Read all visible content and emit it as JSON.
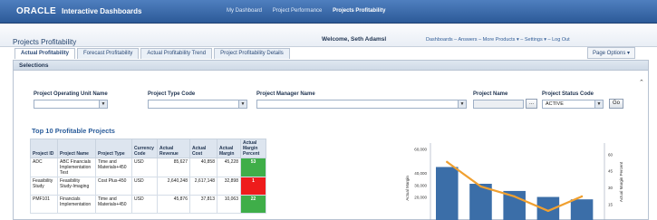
{
  "brand": {
    "logo": "ORACLE",
    "product": "Interactive Dashboards"
  },
  "top_nav": [
    "My Dashboard",
    "Project Performance",
    "Projects Profitability"
  ],
  "top_nav_active": 2,
  "page_title": "Projects Profitability",
  "welcome": "Welcome, Seth Adamsl",
  "right_links": "Dashboards – Answers – More Products ▾ – Settings ▾ – Log Out",
  "tabs": [
    "Actual Profitability",
    "Forecast Profitability",
    "Actual Profitability Trend",
    "Project Profitability Details"
  ],
  "active_tab": 0,
  "page_options": "Page Options ▾",
  "selections": {
    "title": "Selections",
    "prompts": {
      "operating_unit": "Project Operating Unit Name",
      "type_code": "Project Type Code",
      "manager": "Project Manager Name",
      "project_name": "Project Name",
      "status": "Project Status Code"
    },
    "status_value": "ACTIVE",
    "browse_label": "...",
    "go_label": "Go"
  },
  "section_title": "Top 10 Profitable Projects",
  "table": {
    "headers": [
      "Project ID",
      "Project Name",
      "Project Type",
      "Currency Code",
      "Actual Revenue",
      "Actual Cost",
      "Actual Margin",
      "Actual Margin Percent"
    ],
    "rows": [
      [
        "ADC",
        "ABC Financials Implementation Test",
        "Time and Materials+450",
        "USD",
        "85,627",
        "40,858",
        "45,228",
        "53"
      ],
      [
        "Feasibility Study",
        "Feasibility Study-Imaging",
        "Cost Plus-450",
        "USD",
        "2,640,248",
        "2,617,148",
        "32,898",
        "1"
      ],
      [
        "PMF101",
        "Financials Implementation",
        "Time and Materials+450",
        "USD",
        "45,876",
        "37,813",
        "10,063",
        "22"
      ]
    ],
    "pct_colors": [
      "#3fae49",
      "#ee1c1c",
      "#3fae49"
    ]
  },
  "chart_data": {
    "type": "bar",
    "categories": [
      "ADC",
      "Feasibility Study",
      "PMF101",
      "",
      ""
    ],
    "series": [
      {
        "values": [
          45000,
          31000,
          25000,
          20000,
          18000
        ],
        "color": "#3b6ea8"
      },
      {
        "values": [
          53,
          31,
          22,
          9,
          22
        ],
        "color": "#f0a030",
        "type": "line"
      }
    ],
    "ylabel": "Actual Margin",
    "y2label": "Actual Margin Percent",
    "yticks": [
      "60,000",
      "40,000",
      "30,000",
      "20,000"
    ],
    "y2ticks": [
      "60",
      "45",
      "30",
      "15"
    ],
    "ylim": [
      0,
      65000
    ],
    "y2lim": [
      0,
      70
    ]
  }
}
